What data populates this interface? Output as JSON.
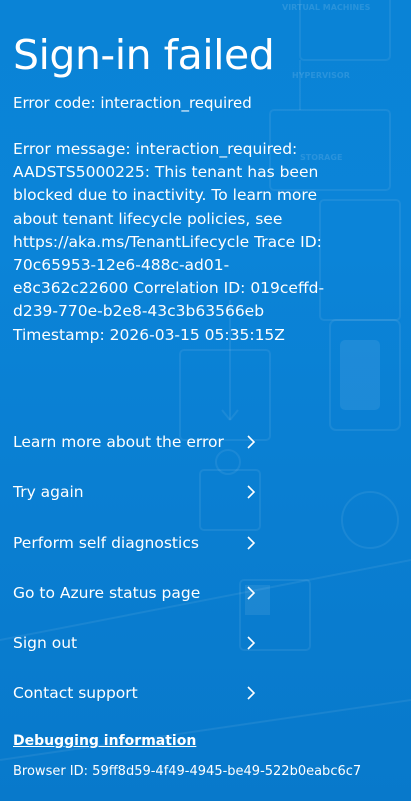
{
  "page": {
    "title": "Sign-in failed",
    "error_code": "Error code: interaction_required",
    "error_message": "Error message: interaction_required: AADSTS5000225: This tenant has been blocked due to inactivity. To learn more about tenant lifecycle policies, see https://aka.ms/TenantLifecycle Trace ID: 70c65953-12e6-488c-ad01-e8c362c22600 Correlation ID: 019ceffd-d239-770e-b2e8-43c3b63566eb Timestamp: 2026-03-15 05:35:15Z"
  },
  "background": {
    "faint_labels": [
      "VIRTUAL MACHINES",
      "HYPERVISOR",
      "STORAGE"
    ]
  },
  "actions": [
    {
      "label": "Learn more about the error",
      "icon": "chevron-right-icon"
    },
    {
      "label": "Try again",
      "icon": "chevron-right-icon"
    },
    {
      "label": "Perform self diagnostics",
      "icon": "chevron-right-icon"
    },
    {
      "label": "Go to Azure status page",
      "icon": "chevron-right-icon"
    },
    {
      "label": "Sign out",
      "icon": "chevron-right-icon"
    },
    {
      "label": "Contact support",
      "icon": "chevron-right-icon"
    }
  ],
  "debug": {
    "link_label": "Debugging information",
    "browser_id": "Browser ID: 59ff8d59-4f49-4945-be49-522b0eabc6c7"
  },
  "colors": {
    "background": "#0a83d6",
    "text": "#ffffff"
  }
}
